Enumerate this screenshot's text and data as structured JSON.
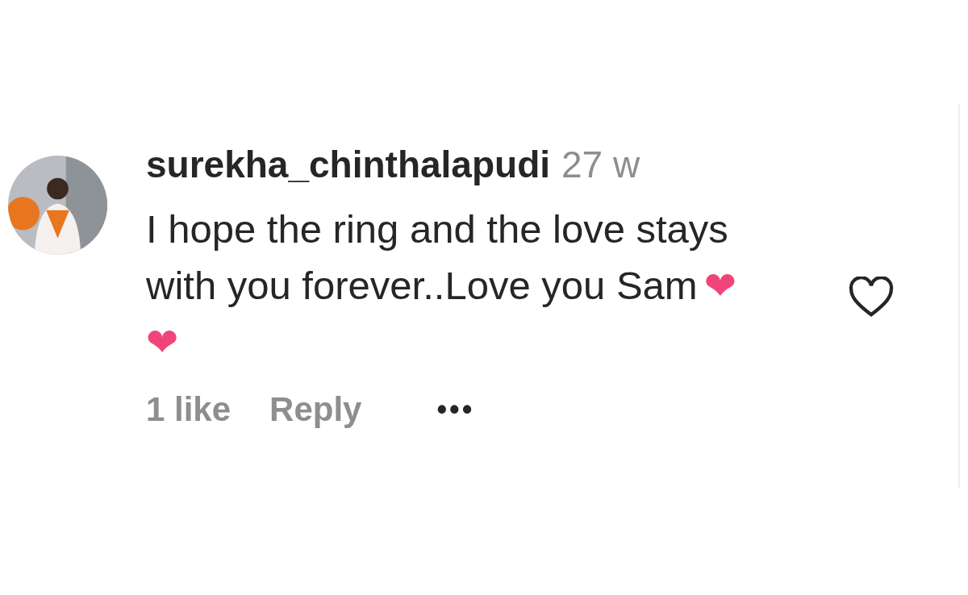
{
  "comment": {
    "username": "surekha_chinthalapudi",
    "time": "27 w",
    "lines": [
      "I hope the ring and the love stays",
      "with you forever..Love you Sam"
    ],
    "emojis": [
      "❤",
      "❤"
    ],
    "liked": false,
    "likes": "1 like",
    "reply": "Reply",
    "more": "•••"
  }
}
